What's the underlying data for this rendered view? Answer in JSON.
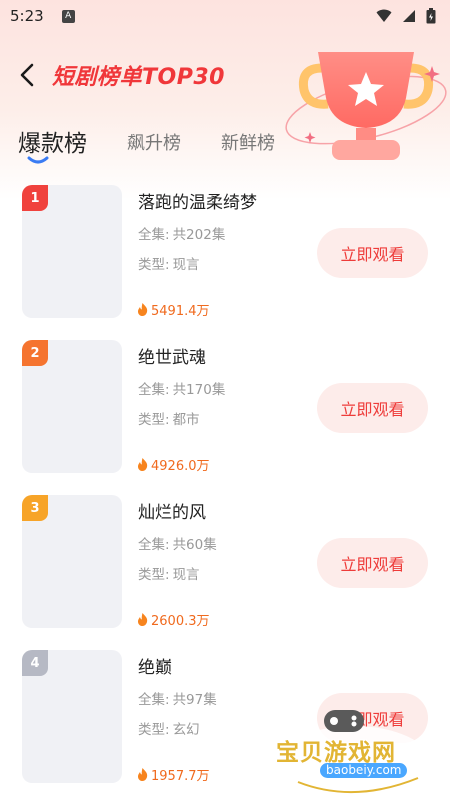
{
  "status_bar": {
    "time": "5:23",
    "badge": "A"
  },
  "header": {
    "title": "短剧榜单TOP30"
  },
  "tabs": [
    {
      "label": "爆款榜",
      "active": true
    },
    {
      "label": "飙升榜",
      "active": false
    },
    {
      "label": "新鲜榜",
      "active": false
    }
  ],
  "list": [
    {
      "rank": "1",
      "rank_color": "#f0423d",
      "title": "落跑的温柔绮梦",
      "ep_label": "全集:",
      "episodes": "共202集",
      "genre_label": "类型:",
      "genre": "现言",
      "heat": "5491.4万",
      "button": "立即观看"
    },
    {
      "rank": "2",
      "rank_color": "#f5742f",
      "title": "绝世武魂",
      "ep_label": "全集:",
      "episodes": "共170集",
      "genre_label": "类型:",
      "genre": "都市",
      "heat": "4926.0万",
      "button": "立即观看"
    },
    {
      "rank": "3",
      "rank_color": "#f7a428",
      "title": "灿烂的风",
      "ep_label": "全集:",
      "episodes": "共60集",
      "genre_label": "类型:",
      "genre": "现言",
      "heat": "2600.3万",
      "button": "立即观看"
    },
    {
      "rank": "4",
      "rank_color": "#b6b9c4",
      "title": "绝巅",
      "ep_label": "全集:",
      "episodes": "共97集",
      "genre_label": "类型:",
      "genre": "玄幻",
      "heat": "1957.7万",
      "button": "立即观看"
    }
  ],
  "watermark": {
    "text": "宝贝游戏网",
    "url": "baobeiy.com"
  },
  "colors": {
    "accent": "#f0373a",
    "heat": "#f06a1e",
    "button_bg": "#fdecea"
  }
}
